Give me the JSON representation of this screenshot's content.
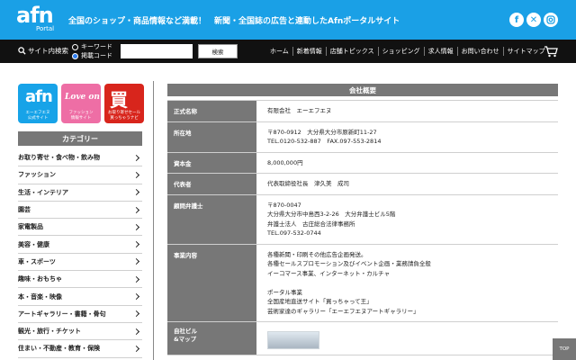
{
  "header": {
    "logo_text": "afn",
    "logo_sub": "Portal",
    "tagline": "全国のショップ・商品情報など満載！　新聞・全国誌の広告と連動したAfnポータルサイト",
    "social_icons": [
      "facebook-icon",
      "x-icon",
      "instagram-icon"
    ]
  },
  "nav": {
    "search_label": "サイト内検索",
    "radio_keyword": "キーワード",
    "radio_code": "掲載コード",
    "search_value": "",
    "search_button": "検索",
    "links": [
      "ホーム",
      "新着情報",
      "店舗トピックス",
      "ショッピング",
      "求人情報",
      "お問い合わせ",
      "サイトマップ"
    ]
  },
  "sidebar": {
    "banners": [
      {
        "mark": "afn",
        "caption": "エーエフエヌ\n公式サイト",
        "color": "#17a3e8"
      },
      {
        "mark": "Love on",
        "caption": "ファッション\n情報サイト",
        "color": "#ee6ea5"
      },
      {
        "mark": "買",
        "caption": "お取り寄せセール\n買っちゃうナビ",
        "color": "#d8251c"
      }
    ],
    "category_title": "カテゴリー",
    "categories": [
      "お取り寄せ・食べ物・飲み物",
      "ファッション",
      "生活・インテリア",
      "園芸",
      "家電製品",
      "美容・健康",
      "車・スポーツ",
      "趣味・おもちゃ",
      "本・音楽・映像",
      "アートギャラリー・書籍・骨句",
      "観光・旅行・チケット",
      "住まい・不動産・教育・保険"
    ]
  },
  "main": {
    "title": "会社概要",
    "rows": [
      {
        "key": "正式名称",
        "lines": [
          "有限会社　エーエフエヌ"
        ]
      },
      {
        "key": "所在地",
        "lines": [
          "〒870-0912　大分県大分市原新町11-27",
          "TEL.0120-532-887　FAX.097-553-2814"
        ]
      },
      {
        "key": "資本金",
        "lines": [
          "8,000,000円"
        ]
      },
      {
        "key": "代表者",
        "lines": [
          "代表取締役社長　津久美　成司"
        ]
      },
      {
        "key": "顧問弁護士",
        "lines": [
          "〒870-0047",
          "大分県大分市中島西3-2-26　大分弁護士ビル5階",
          "弁護士法人　古庄総合法律事務所",
          "TEL.097-532-0744"
        ]
      },
      {
        "key": "事業内容",
        "lines": [
          "各種新聞・印刷その他広告企画発送。",
          "各種セールスプロモーション及びイベント企画・業務請負全般",
          "イーコマース事業、インターネット・カルチャ",
          "",
          "ポータル事業",
          "全国産地直送サイト「買っちゃって王」",
          "芸術家達のギャラリー「エーエフエヌアートギャラリー」"
        ]
      },
      {
        "key": "自社ビル\n&マップ",
        "lines": []
      }
    ]
  },
  "top_button": "TOP",
  "colors": {
    "brand": "#1aa0e6",
    "nav_bg": "#111111",
    "header_gray": "#777777"
  }
}
